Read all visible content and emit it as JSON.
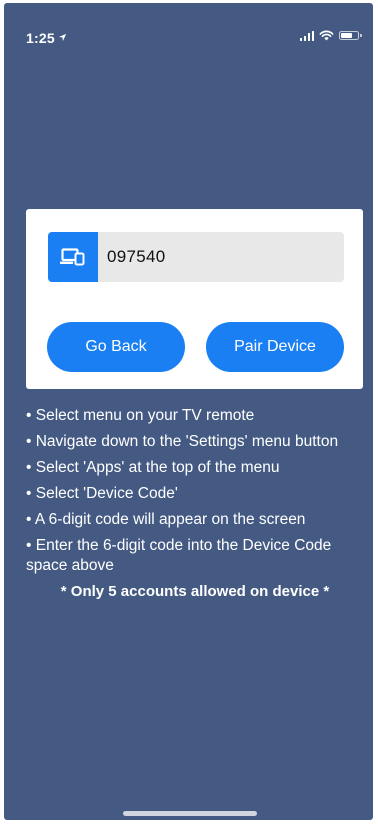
{
  "status_bar": {
    "time": "1:25"
  },
  "device_code": {
    "value": "097540"
  },
  "buttons": {
    "go_back": "Go Back",
    "pair_device": "Pair Device"
  },
  "instructions": [
    "• Select menu on your TV remote",
    "• Navigate down to the 'Settings' menu button",
    "• Select 'Apps' at the top of the menu",
    "• Select 'Device Code'",
    "• A 6-digit code will appear on the screen",
    "• Enter the 6-digit code into the Device Code space above"
  ],
  "note": "* Only 5 accounts allowed on device *",
  "colors": {
    "background": "#455a83",
    "accent": "#1a7ff2",
    "field": "#e8e8e8"
  }
}
